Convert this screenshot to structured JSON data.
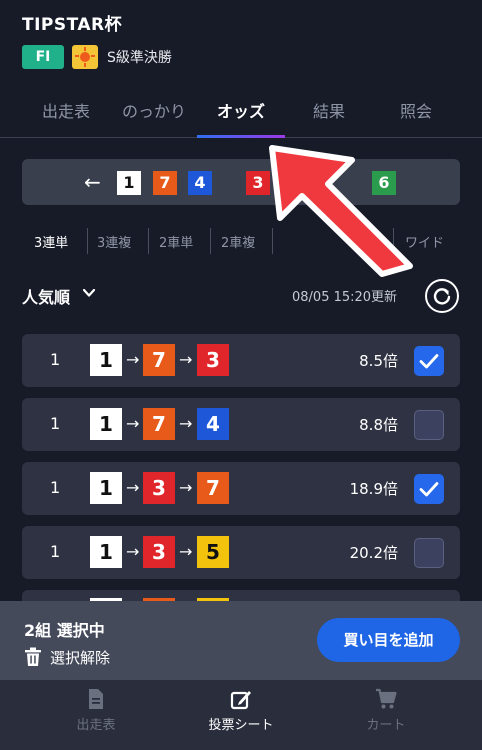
{
  "header": {
    "title": "TIPSTAR杯",
    "grade_badge": "FI",
    "weather_icon": "sun-icon",
    "race_name": "S級準決勝"
  },
  "tabs": [
    {
      "label": "出走表"
    },
    {
      "label": "のっかり"
    },
    {
      "label": "オッズ"
    },
    {
      "label": "結果"
    },
    {
      "label": "照会"
    }
  ],
  "combo": {
    "back_glyph": "←",
    "numbers": [
      {
        "n": "1",
        "bg": "#ffffff",
        "fg": "#111111"
      },
      {
        "n": "7",
        "bg": "#e85a19",
        "fg": "#ffffff"
      },
      {
        "n": "4",
        "bg": "#1e58d8",
        "fg": "#ffffff"
      },
      {
        "n": "3",
        "bg": "#e0262b",
        "fg": "#ffffff"
      },
      {
        "n": "6",
        "bg": "#2b9b4d",
        "fg": "#ffffff"
      }
    ]
  },
  "bet_types": [
    "3連単",
    "3連複",
    "2車単",
    "2車複",
    "ワイド"
  ],
  "sort": {
    "label": "人気順",
    "updated": "08/05 15:20更新"
  },
  "rows": [
    {
      "rank": "1",
      "n1": "1",
      "n2": "7",
      "n3": "3",
      "odds": "8.5倍",
      "checked": true
    },
    {
      "rank": "1",
      "n1": "1",
      "n2": "7",
      "n3": "4",
      "odds": "8.8倍",
      "checked": false
    },
    {
      "rank": "1",
      "n1": "1",
      "n2": "3",
      "n3": "7",
      "odds": "18.9倍",
      "checked": true
    },
    {
      "rank": "1",
      "n1": "1",
      "n2": "3",
      "n3": "5",
      "odds": "20.2倍",
      "checked": false
    }
  ],
  "selection": {
    "count": "2組 選択中",
    "clear": "選択解除",
    "add": "買い目を追加"
  },
  "nav": [
    {
      "label": "出走表",
      "icon": "document-icon"
    },
    {
      "label": "投票シート",
      "icon": "edit-icon"
    },
    {
      "label": "カート",
      "icon": "cart-icon"
    }
  ],
  "colors": {
    "background": "#171b28",
    "accent": "#1f66e6",
    "tab_underline": [
      "#2f6ff2",
      "#9b3ae6"
    ],
    "pointer_arrow": "#f0393f",
    "box_1": "#ffffff",
    "box_3": "#e0262b",
    "box_4": "#1e58d8",
    "box_5": "#f3c20c",
    "box_7": "#e85a19"
  }
}
